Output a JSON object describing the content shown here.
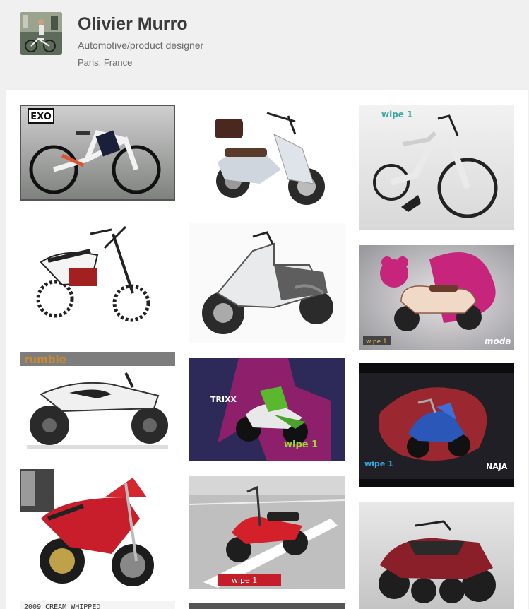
{
  "profile": {
    "name": "Olivier Murro",
    "occupation": "Automotive/product designer",
    "location": "Paris, France"
  },
  "projects": [
    {
      "subject": "white electric mountain bike",
      "logo": "EXO"
    },
    {
      "subject": "white scooter with top case",
      "logo": ""
    },
    {
      "subject": "white city electric bike",
      "logo": "wipe 1"
    },
    {
      "subject": "white dirt bike sketch",
      "logo": ""
    },
    {
      "subject": "white sport scooter",
      "logo": ""
    },
    {
      "subject": "cream retro scooter",
      "logo": "moda"
    },
    {
      "subject": "white kids quad",
      "logo": "rumble"
    },
    {
      "subject": "green scooter",
      "logo": "TRIXX"
    },
    {
      "subject": "blue scooter",
      "logo": "NAJA"
    },
    {
      "subject": "red sport motorcycle",
      "logo": ""
    },
    {
      "subject": "red scooter",
      "logo": "wipe 1"
    },
    {
      "subject": "red quad",
      "logo": ""
    },
    {
      "subject": "sketch",
      "logo": "2009 CREAM WHIPPED"
    },
    {
      "subject": "dark project",
      "logo": ""
    }
  ],
  "colors": {
    "background": "#f0f0f0",
    "panel": "#ffffff",
    "name_text": "#3a3a3a",
    "secondary_text": "#6b6b6b"
  }
}
